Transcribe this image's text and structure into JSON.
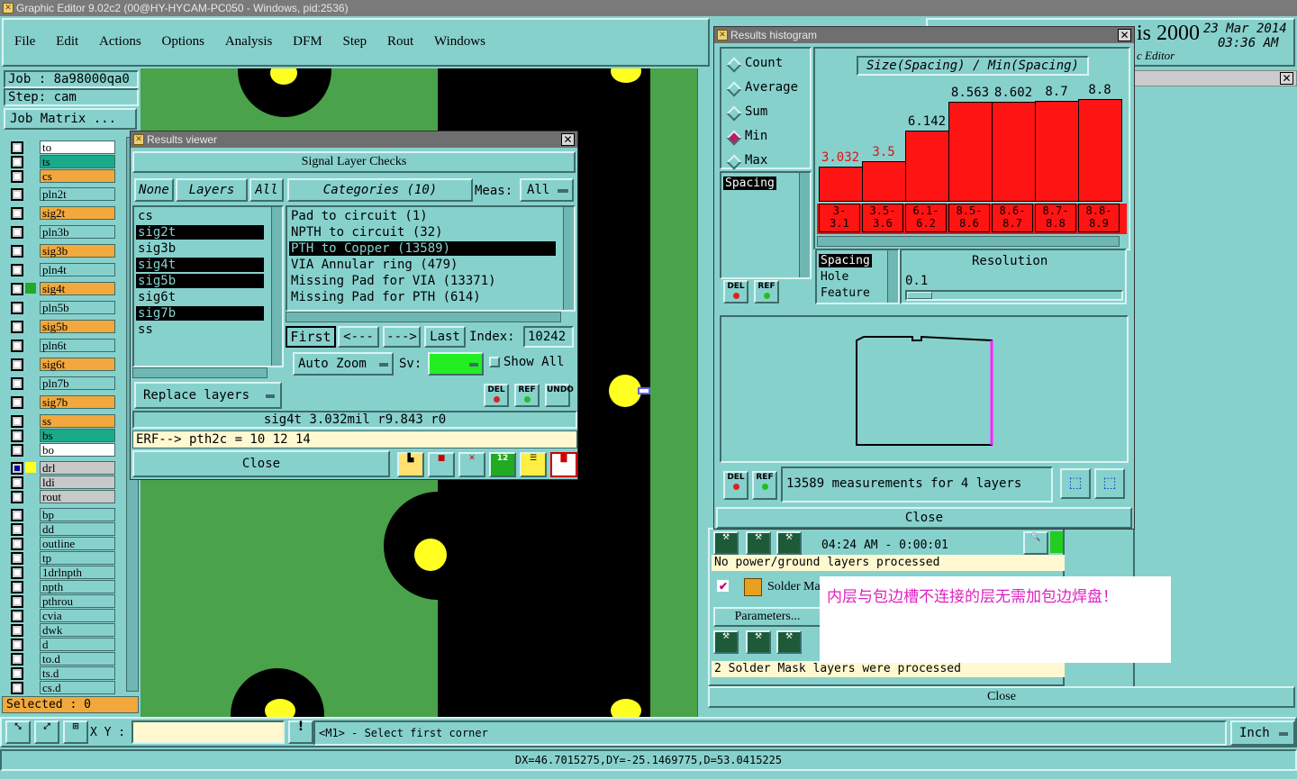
{
  "window": {
    "title": "Graphic Editor 9.02c2 (00@HY-HYCAM-PC050 - Windows, pid:2536)"
  },
  "menu": [
    "File",
    "Edit",
    "Actions",
    "Options",
    "Analysis",
    "DFM",
    "Step",
    "Rout",
    "Windows"
  ],
  "job": {
    "job_label": "Job : 8a98000qa0",
    "step_label": "Step: cam",
    "job_matrix": "Job Matrix ..."
  },
  "layers": [
    "to",
    "ts",
    "cs",
    "pln2t",
    "sig2t",
    "pln3b",
    "sig3b",
    "pln4t",
    "sig4t",
    "pln5b",
    "sig5b",
    "pln6t",
    "sig6t",
    "pln7b",
    "sig7b",
    "ss",
    "bs",
    "bo",
    "drl",
    "ldi",
    "rout",
    "bp",
    "dd",
    "outline",
    "tp",
    "1drlnpth",
    "npth",
    "pthrou",
    "cvia",
    "dwk",
    "d",
    "to.d",
    "ts.d",
    "cs.d"
  ],
  "selected": "Selected : 0",
  "genesis": {
    "brand": "is 2000",
    "date": "23 Mar 2014",
    "time": "03:36 AM",
    "subtitle": "c Editor"
  },
  "results_viewer": {
    "title": "Results viewer",
    "header": "Signal Layer Checks",
    "none": "None",
    "layers_label": "Layers",
    "all": "All",
    "layer_list": [
      "cs",
      "sig2t",
      "sig3b",
      "sig4t",
      "sig5b",
      "sig6t",
      "sig7b",
      "ss"
    ],
    "highlighted_layers": [
      "sig2t",
      "sig4t",
      "sig5b",
      "sig7b"
    ],
    "categories_label": "Categories (10)",
    "meas_label": "Meas:",
    "meas_value": "All",
    "categories": [
      "Pad to circuit (1)",
      "NPTH to circuit (32)",
      "PTH to Copper (13589)",
      "VIA Annular ring (479)",
      "Missing Pad for VIA (13371)",
      "Missing Pad for PTH (614)"
    ],
    "selected_category": "PTH to Copper (13589)",
    "nav": {
      "first": "First",
      "prev": "<---",
      "next": "--->",
      "last": "Last",
      "index_label": "Index:",
      "index_value": "10242"
    },
    "auto_zoom": "Auto Zoom",
    "sv_label": "Sv:",
    "show_all": "Show All",
    "replace_layers": "Replace layers",
    "status": "sig4t 3.032mil  r9.843  r0",
    "erf": "ERF--> pth2c = 10 12 14",
    "close": "Close",
    "icons": {
      "del": "DEL",
      "ref": "REF",
      "undo": "UNDO"
    }
  },
  "histogram": {
    "title": "Results histogram",
    "modes": [
      "Count",
      "Average",
      "Sum",
      "Min",
      "Max"
    ],
    "selected_mode": "Min",
    "list_item": "Spacing",
    "heading": "Size(Spacing) / Min(Spacing)",
    "bar_values": [
      "3.032",
      "3.5",
      "6.142",
      "8.563",
      "8.602",
      "8.7",
      "8.8"
    ],
    "bins": [
      [
        "3-",
        "3.1"
      ],
      [
        "3.5-",
        "3.6"
      ],
      [
        "6.1-",
        "6.2"
      ],
      [
        "8.5-",
        "8.6"
      ],
      [
        "8.6-",
        "8.7"
      ],
      [
        "8.7-",
        "8.8"
      ],
      [
        "8.8-",
        "8.9"
      ]
    ],
    "types": [
      "Spacing",
      "Hole",
      "Feature"
    ],
    "resolution_label": "Resolution",
    "resolution_value": "0.1",
    "measure_text": "13589 measurements for 4 layers",
    "close": "Close",
    "del": "DEL",
    "ref": "REF"
  },
  "chart_data": {
    "type": "bar",
    "title": "Size(Spacing) / Min(Spacing)",
    "categories": [
      "3-3.1",
      "3.5-3.6",
      "6.1-6.2",
      "8.5-8.6",
      "8.6-8.7",
      "8.7-8.8",
      "8.8-8.9"
    ],
    "values": [
      3.032,
      3.5,
      6.142,
      8.563,
      8.602,
      8.7,
      8.8
    ]
  },
  "back_panel": {
    "time": "04:24 AM - 0:00:01",
    "msg1": "No power/ground layers processed",
    "solder": "Solder Ma",
    "params": "Parameters...",
    "msg2": "2 Solder Mask layers were processed",
    "close": "Close"
  },
  "note": "内层与包边槽不连接的层无需加包边焊盘！",
  "bottom": {
    "xy": "X Y :",
    "prompt": "<M1> - Select first corner",
    "unit": "Inch",
    "coords": "DX=46.7015275,DY=-25.1469775,D=53.0415225"
  },
  "colors": {
    "accent": "#87d1cd",
    "pcb_green": "#4aa24a",
    "pad": "#ffff22",
    "bar": "#ff1414"
  }
}
